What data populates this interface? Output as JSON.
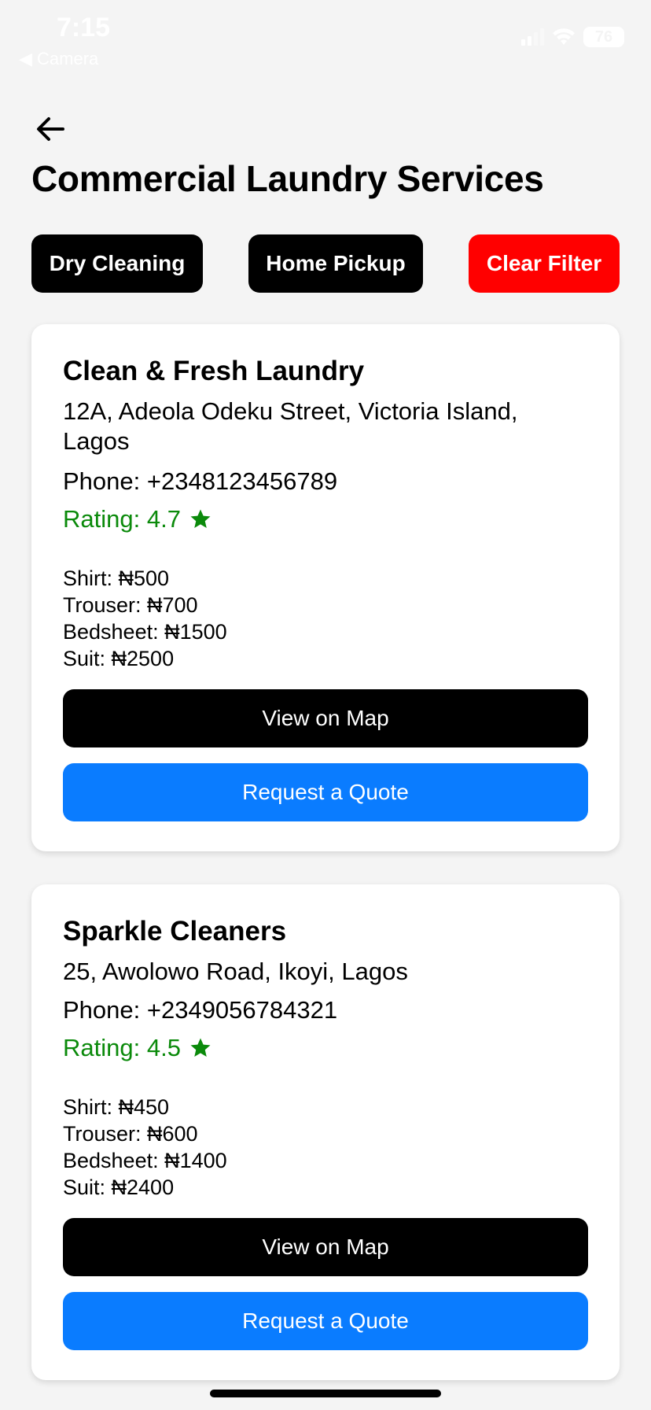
{
  "status_bar": {
    "time": "7:15",
    "back_app": "◀ Camera",
    "battery": "76"
  },
  "header": {
    "title": "Commercial Laundry Services"
  },
  "filters": {
    "dry_cleaning": "Dry Cleaning",
    "home_pickup": "Home Pickup",
    "clear": "Clear Filter"
  },
  "colors": {
    "accent_blue": "#0a7cff",
    "clear_red": "#ff0000",
    "rating_green": "#0b8a0b"
  },
  "laundries": [
    {
      "name": "Clean & Fresh Laundry",
      "address": "12A, Adeola Odeku Street, Victoria Island, Lagos",
      "phone": "Phone: +2348123456789",
      "rating": "Rating: 4.7",
      "prices": [
        "Shirt: ₦500",
        "Trouser: ₦700",
        "Bedsheet: ₦1500",
        "Suit: ₦2500"
      ],
      "map_label": "View on Map",
      "quote_label": "Request a Quote"
    },
    {
      "name": "Sparkle Cleaners",
      "address": "25, Awolowo Road, Ikoyi, Lagos",
      "phone": "Phone: +2349056784321",
      "rating": "Rating: 4.5",
      "prices": [
        "Shirt: ₦450",
        "Trouser: ₦600",
        "Bedsheet: ₦1400",
        "Suit: ₦2400"
      ],
      "map_label": "View on Map",
      "quote_label": "Request a Quote"
    }
  ]
}
